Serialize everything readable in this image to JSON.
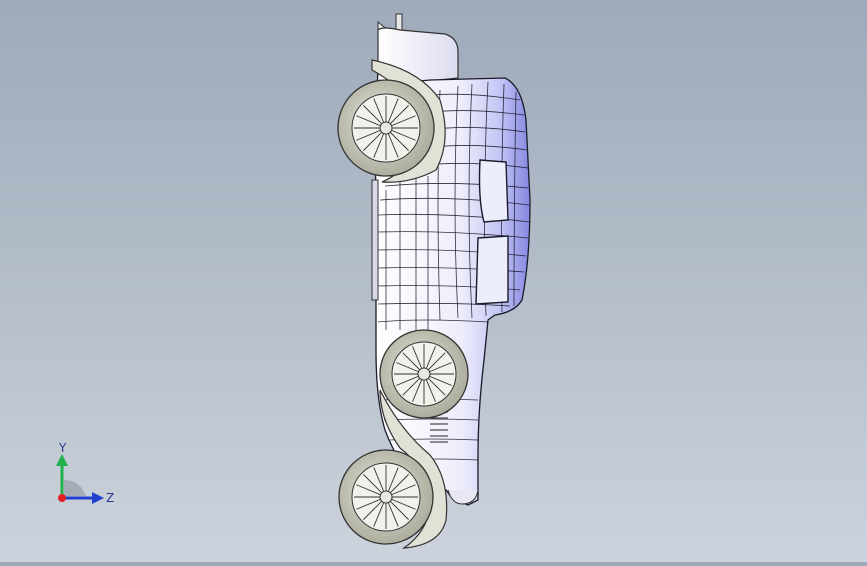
{
  "viewport": {
    "background_top": "#9eaaba",
    "background_bottom": "#cdd3dc",
    "model": "car-side-view"
  },
  "triad": {
    "y_label": "Y",
    "z_label": "Z",
    "colors": {
      "y_axis": "#22b14c",
      "z_axis": "#2040d0",
      "x_axis": "#e02020"
    }
  },
  "colors": {
    "body_fill": "#eceefa",
    "body_shade": "#c7c8f6",
    "body_deep": "#8e90e6",
    "edge": "#1a1a2a",
    "tire": "#c7c7b8",
    "fender": "#dcdcd2"
  }
}
